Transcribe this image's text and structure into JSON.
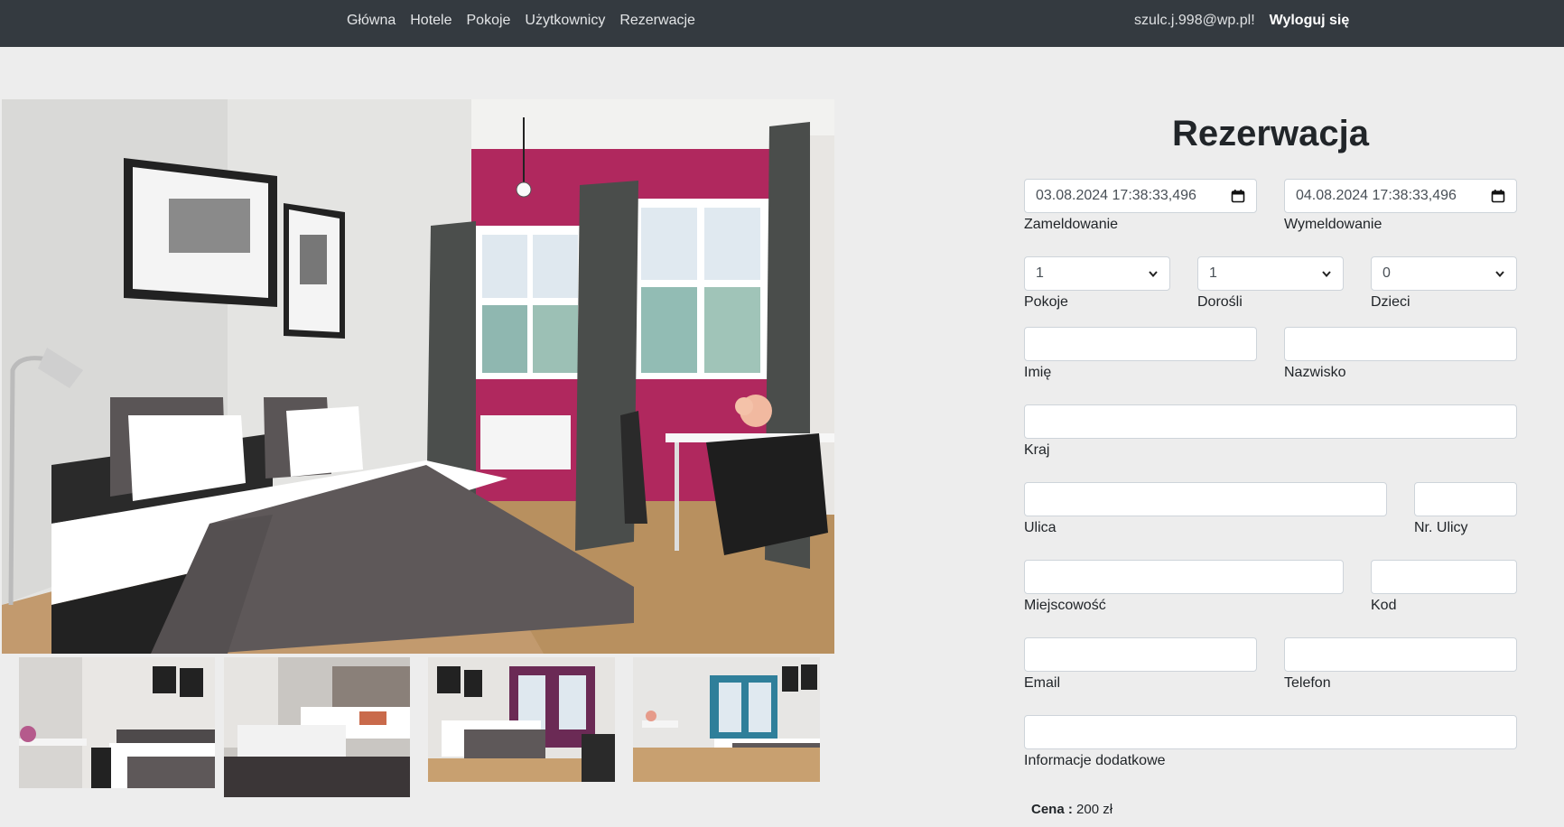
{
  "nav": {
    "links": [
      "Główna",
      "Hotele",
      "Pokoje",
      "Użytkownicy",
      "Rezerwacje"
    ],
    "user_email": "szulc.j.998@wp.pl!",
    "logout": "Wyloguj się"
  },
  "form": {
    "title": "Rezerwacja",
    "checkin": {
      "value": "03.08.2024 17:38:33,496",
      "label": "Zameldowanie"
    },
    "checkout": {
      "value": "04.08.2024 17:38:33,496",
      "label": "Wymeldowanie"
    },
    "rooms": {
      "value": "1",
      "label": "Pokoje"
    },
    "adults": {
      "value": "1",
      "label": "Dorośli"
    },
    "children": {
      "value": "0",
      "label": "Dzieci"
    },
    "first_name": {
      "value": "",
      "label": "Imię"
    },
    "last_name": {
      "value": "",
      "label": "Nazwisko"
    },
    "country": {
      "value": "",
      "label": "Kraj"
    },
    "street": {
      "value": "",
      "label": "Ulica"
    },
    "street_no": {
      "value": "",
      "label": "Nr. Ulicy"
    },
    "city": {
      "value": "",
      "label": "Miejscowość"
    },
    "postal_code": {
      "value": "",
      "label": "Kod"
    },
    "email": {
      "value": "",
      "label": "Email"
    },
    "phone": {
      "value": "",
      "label": "Telefon"
    },
    "notes": {
      "value": "",
      "label": "Informacje dodatkowe"
    },
    "price_label": "Cena :",
    "price_value": "200 zł"
  },
  "icons": {
    "calendar": "calendar-icon",
    "select_arrow": "chevron-down-icon"
  },
  "colors": {
    "navbar": "#343a40",
    "background": "#ededed",
    "accent_wall": "#b0285e"
  }
}
